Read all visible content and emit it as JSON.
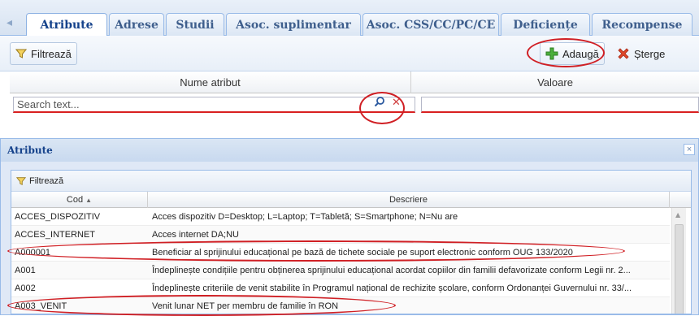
{
  "tabs": [
    {
      "label": "Atribute",
      "active": true
    },
    {
      "label": "Adrese",
      "active": false
    },
    {
      "label": "Studii",
      "active": false
    },
    {
      "label": "Asoc. suplimentar",
      "active": false
    },
    {
      "label": "Asoc. CSS/CC/PC/CE",
      "active": false
    },
    {
      "label": "Deficiențe",
      "active": false
    },
    {
      "label": "Recompense",
      "active": false
    }
  ],
  "toolbar": {
    "filter_label": "Filtrează",
    "add_label": "Adaugă",
    "delete_label": "Șterge"
  },
  "grid": {
    "columns": [
      "Nume atribut",
      "Valoare"
    ],
    "search_placeholder": "Search text..."
  },
  "dialog": {
    "title": "Atribute",
    "close_symbol": "×",
    "filter_label": "Filtrează",
    "columns": [
      "Cod",
      "Descriere"
    ],
    "sort_indicator": "▲",
    "rows": [
      {
        "cod": "ACCES_DISPOZITIV",
        "descriere": "Acces dispozitiv D=Desktop; L=Laptop; T=Tabletă; S=Smartphone; N=Nu are"
      },
      {
        "cod": "ACCES_INTERNET",
        "descriere": "Acces internet DA;NU"
      },
      {
        "cod": "A000001",
        "descriere": "Beneficiar al sprijinului educațional pe bază de tichete sociale pe suport electronic conform OUG 133/2020"
      },
      {
        "cod": "A001",
        "descriere": "Îndeplinește condițiile pentru obținerea sprijinului educațional acordat copiilor din familii defavorizate conform Legii nr. 2..."
      },
      {
        "cod": "A002",
        "descriere": "Îndeplinește criteriile de venit stabilite în Programul național de rechizite școlare, conform Ordonanței Guvernului nr. 33/..."
      },
      {
        "cod": "A003_VENIT",
        "descriere": "Venit lunar NET per membru de familie în RON"
      }
    ]
  },
  "colors": {
    "annotation": "#d01f24",
    "accent": "#15428b"
  }
}
